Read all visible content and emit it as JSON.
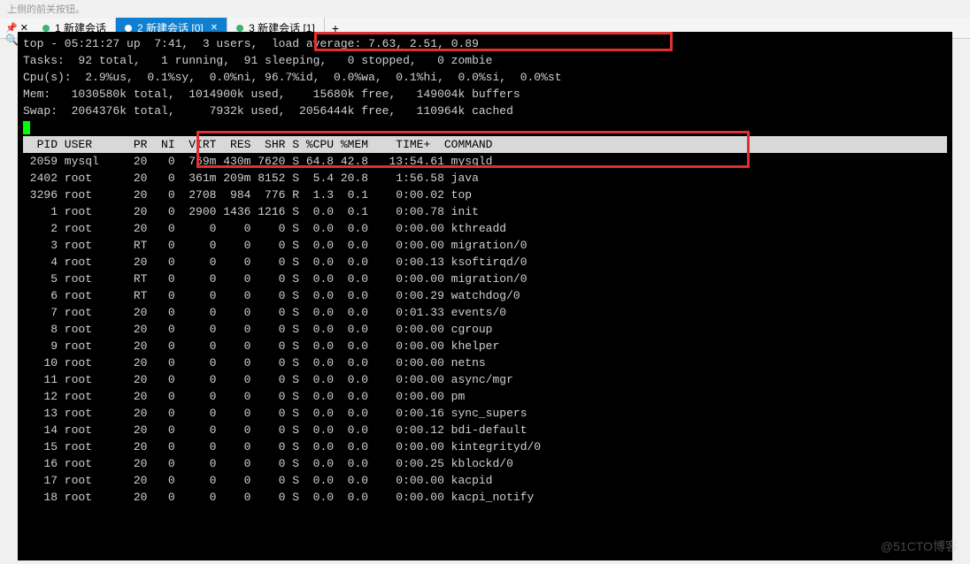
{
  "top_hint": "上侧的前关按钮。",
  "tabs": [
    {
      "num": "1",
      "label": "新建会话",
      "suffix": "",
      "active": false
    },
    {
      "num": "2",
      "label": "新建会话",
      "suffix": " [0]",
      "active": true
    },
    {
      "num": "3",
      "label": "新建会话",
      "suffix": " [1]",
      "active": false
    }
  ],
  "add_tab": "+",
  "top_summary": {
    "prefix": "top - 05:21:27 up  7:41,  3 users,  ",
    "load_avg": "load average: 7.63, 2.51, 0.89"
  },
  "tasks_line": "Tasks:  92 total,   1 running,  91 sleeping,   0 stopped,   0 zombie",
  "cpu_line": "Cpu(s):  2.9%us,  0.1%sy,  0.0%ni, 96.7%id,  0.0%wa,  0.1%hi,  0.0%si,  0.0%st",
  "mem_line": "Mem:   1030580k total,  1014900k used,    15680k free,   149004k buffers",
  "swap_line": "Swap:  2064376k total,     7932k used,  2056444k free,   110964k cached",
  "cursor": " ",
  "header_cols": "  PID USER      PR  NI  VIRT  RES  SHR S %CPU %MEM    TIME+  COMMAND",
  "processes": [
    {
      "pid": "2059",
      "user": "mysql",
      "pr": "20",
      "ni": "0",
      "virt": "769m",
      "res": "430m",
      "shr": "7620",
      "s": "S",
      "cpu": "64.8",
      "mem": "42.8",
      "time": "13:54.61",
      "cmd": "mysqld"
    },
    {
      "pid": "2402",
      "user": "root",
      "pr": "20",
      "ni": "0",
      "virt": "361m",
      "res": "209m",
      "shr": "8152",
      "s": "S",
      "cpu": "5.4",
      "mem": "20.8",
      "time": "1:56.58",
      "cmd": "java"
    },
    {
      "pid": "3296",
      "user": "root",
      "pr": "20",
      "ni": "0",
      "virt": "2708",
      "res": "984",
      "shr": "776",
      "s": "R",
      "cpu": "1.3",
      "mem": "0.1",
      "time": "0:00.02",
      "cmd": "top"
    },
    {
      "pid": "1",
      "user": "root",
      "pr": "20",
      "ni": "0",
      "virt": "2900",
      "res": "1436",
      "shr": "1216",
      "s": "S",
      "cpu": "0.0",
      "mem": "0.1",
      "time": "0:00.78",
      "cmd": "init"
    },
    {
      "pid": "2",
      "user": "root",
      "pr": "20",
      "ni": "0",
      "virt": "0",
      "res": "0",
      "shr": "0",
      "s": "S",
      "cpu": "0.0",
      "mem": "0.0",
      "time": "0:00.00",
      "cmd": "kthreadd"
    },
    {
      "pid": "3",
      "user": "root",
      "pr": "RT",
      "ni": "0",
      "virt": "0",
      "res": "0",
      "shr": "0",
      "s": "S",
      "cpu": "0.0",
      "mem": "0.0",
      "time": "0:00.00",
      "cmd": "migration/0"
    },
    {
      "pid": "4",
      "user": "root",
      "pr": "20",
      "ni": "0",
      "virt": "0",
      "res": "0",
      "shr": "0",
      "s": "S",
      "cpu": "0.0",
      "mem": "0.0",
      "time": "0:00.13",
      "cmd": "ksoftirqd/0"
    },
    {
      "pid": "5",
      "user": "root",
      "pr": "RT",
      "ni": "0",
      "virt": "0",
      "res": "0",
      "shr": "0",
      "s": "S",
      "cpu": "0.0",
      "mem": "0.0",
      "time": "0:00.00",
      "cmd": "migration/0"
    },
    {
      "pid": "6",
      "user": "root",
      "pr": "RT",
      "ni": "0",
      "virt": "0",
      "res": "0",
      "shr": "0",
      "s": "S",
      "cpu": "0.0",
      "mem": "0.0",
      "time": "0:00.29",
      "cmd": "watchdog/0"
    },
    {
      "pid": "7",
      "user": "root",
      "pr": "20",
      "ni": "0",
      "virt": "0",
      "res": "0",
      "shr": "0",
      "s": "S",
      "cpu": "0.0",
      "mem": "0.0",
      "time": "0:01.33",
      "cmd": "events/0"
    },
    {
      "pid": "8",
      "user": "root",
      "pr": "20",
      "ni": "0",
      "virt": "0",
      "res": "0",
      "shr": "0",
      "s": "S",
      "cpu": "0.0",
      "mem": "0.0",
      "time": "0:00.00",
      "cmd": "cgroup"
    },
    {
      "pid": "9",
      "user": "root",
      "pr": "20",
      "ni": "0",
      "virt": "0",
      "res": "0",
      "shr": "0",
      "s": "S",
      "cpu": "0.0",
      "mem": "0.0",
      "time": "0:00.00",
      "cmd": "khelper"
    },
    {
      "pid": "10",
      "user": "root",
      "pr": "20",
      "ni": "0",
      "virt": "0",
      "res": "0",
      "shr": "0",
      "s": "S",
      "cpu": "0.0",
      "mem": "0.0",
      "time": "0:00.00",
      "cmd": "netns"
    },
    {
      "pid": "11",
      "user": "root",
      "pr": "20",
      "ni": "0",
      "virt": "0",
      "res": "0",
      "shr": "0",
      "s": "S",
      "cpu": "0.0",
      "mem": "0.0",
      "time": "0:00.00",
      "cmd": "async/mgr"
    },
    {
      "pid": "12",
      "user": "root",
      "pr": "20",
      "ni": "0",
      "virt": "0",
      "res": "0",
      "shr": "0",
      "s": "S",
      "cpu": "0.0",
      "mem": "0.0",
      "time": "0:00.00",
      "cmd": "pm"
    },
    {
      "pid": "13",
      "user": "root",
      "pr": "20",
      "ni": "0",
      "virt": "0",
      "res": "0",
      "shr": "0",
      "s": "S",
      "cpu": "0.0",
      "mem": "0.0",
      "time": "0:00.16",
      "cmd": "sync_supers"
    },
    {
      "pid": "14",
      "user": "root",
      "pr": "20",
      "ni": "0",
      "virt": "0",
      "res": "0",
      "shr": "0",
      "s": "S",
      "cpu": "0.0",
      "mem": "0.0",
      "time": "0:00.12",
      "cmd": "bdi-default"
    },
    {
      "pid": "15",
      "user": "root",
      "pr": "20",
      "ni": "0",
      "virt": "0",
      "res": "0",
      "shr": "0",
      "s": "S",
      "cpu": "0.0",
      "mem": "0.0",
      "time": "0:00.00",
      "cmd": "kintegrityd/0"
    },
    {
      "pid": "16",
      "user": "root",
      "pr": "20",
      "ni": "0",
      "virt": "0",
      "res": "0",
      "shr": "0",
      "s": "S",
      "cpu": "0.0",
      "mem": "0.0",
      "time": "0:00.25",
      "cmd": "kblockd/0"
    },
    {
      "pid": "17",
      "user": "root",
      "pr": "20",
      "ni": "0",
      "virt": "0",
      "res": "0",
      "shr": "0",
      "s": "S",
      "cpu": "0.0",
      "mem": "0.0",
      "time": "0:00.00",
      "cmd": "kacpid"
    },
    {
      "pid": "18",
      "user": "root",
      "pr": "20",
      "ni": "0",
      "virt": "0",
      "res": "0",
      "shr": "0",
      "s": "S",
      "cpu": "0.0",
      "mem": "0.0",
      "time": "0:00.00",
      "cmd": "kacpi_notify"
    }
  ],
  "watermark": "@51CTO博客"
}
